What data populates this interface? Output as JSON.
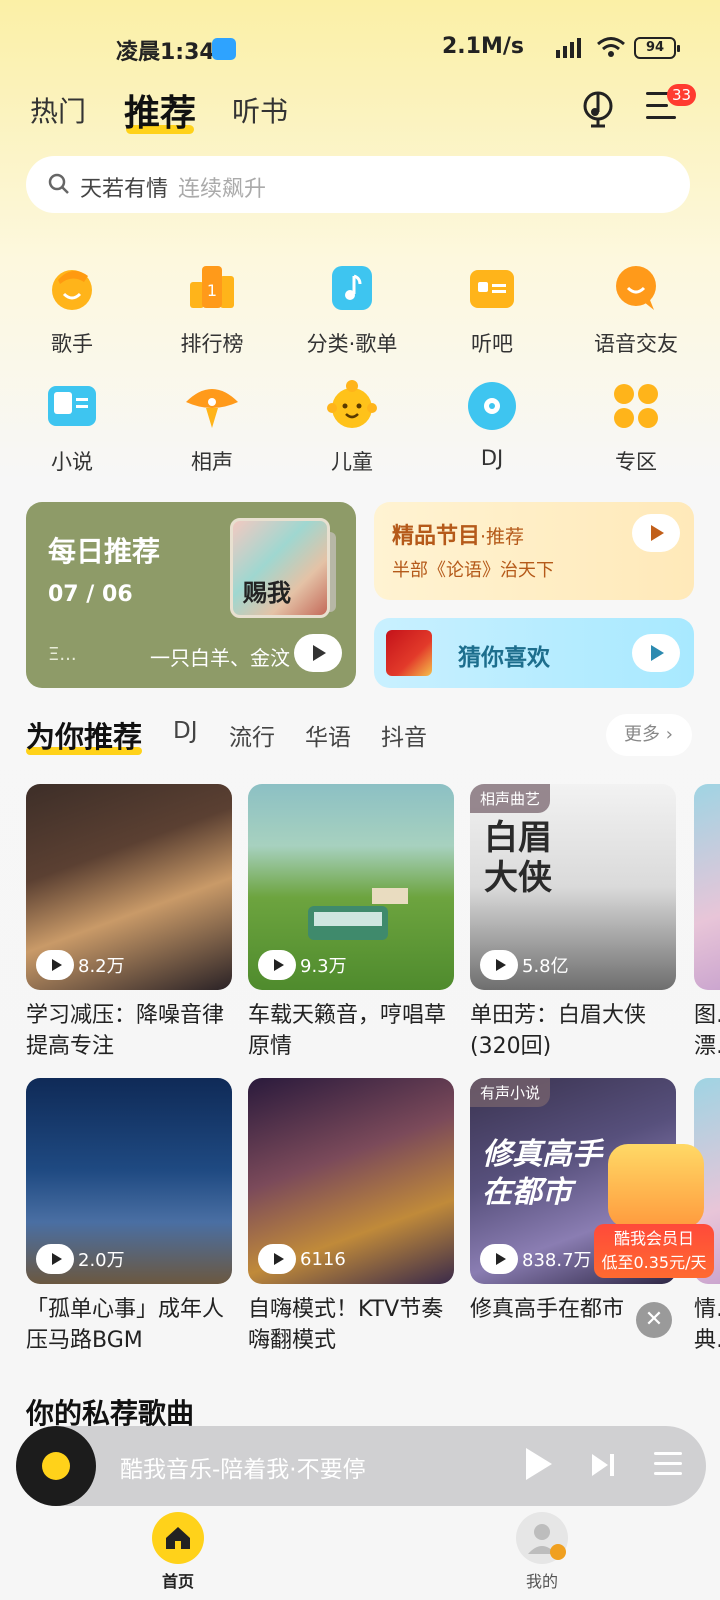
{
  "status_bar": {
    "time": "凌晨1:34",
    "net_speed": "2.1M/s",
    "battery": "94"
  },
  "top_tabs": [
    {
      "label": "热门",
      "active": false
    },
    {
      "label": "推荐",
      "active": true
    },
    {
      "label": "听书",
      "active": false
    }
  ],
  "menu_badge": "33",
  "search": {
    "keyword": "天若有情",
    "hint": "连续飙升",
    "icon": "search-icon"
  },
  "grid": [
    {
      "label": "歌手",
      "icon": "singer-icon",
      "color": "#ffb41a"
    },
    {
      "label": "排行榜",
      "icon": "chart-icon",
      "color": "#ff9a1a"
    },
    {
      "label": "分类·歌单",
      "icon": "music-note-icon",
      "color": "#3ec5f0"
    },
    {
      "label": "听吧",
      "icon": "radio-icon",
      "color": "#ffb41a"
    },
    {
      "label": "语音交友",
      "icon": "chat-icon",
      "color": "#ff9a1a"
    },
    {
      "label": "小说",
      "icon": "book-icon",
      "color": "#3ec5f0"
    },
    {
      "label": "相声",
      "icon": "fan-icon",
      "color": "#ff9a1a"
    },
    {
      "label": "儿童",
      "icon": "kid-icon",
      "color": "#ffc21a"
    },
    {
      "label": "DJ",
      "icon": "disc-icon",
      "color": "#3ec5f0"
    },
    {
      "label": "专区",
      "icon": "apps-icon",
      "color": "#ffb41a"
    }
  ],
  "daily": {
    "title": "每日推荐",
    "date_m": "07",
    "date_sep": "/",
    "date_d": "06",
    "cover_text": "赐我",
    "dots": "Ξ...",
    "artist": "一只白羊、金汶"
  },
  "jingpin": {
    "title": "精品节目",
    "suffix": "·推荐",
    "subtitle": "半部《论语》治天下"
  },
  "guess": {
    "title": "猜你喜欢"
  },
  "section_tabs": [
    {
      "label": "为你推荐",
      "active": true
    },
    {
      "label": "DJ",
      "active": false
    },
    {
      "label": "流行",
      "active": false
    },
    {
      "label": "华语",
      "active": false
    },
    {
      "label": "抖音",
      "active": false
    }
  ],
  "more": "更多",
  "playlists": [
    {
      "title": "学习减压：降噪音律提高专注",
      "count": "8.2万",
      "tag": ""
    },
    {
      "title": "车载天籁音，哼唱草原情",
      "count": "9.3万",
      "tag": ""
    },
    {
      "title": "单田芳：白眉大侠(320回)",
      "count": "5.8亿",
      "tag": "相声曲艺",
      "cover_text": "白眉大侠"
    },
    {
      "title": "图…漂…",
      "count": "",
      "tag": ""
    },
    {
      "title": "「孤单心事」成年人压马路BGM",
      "count": "2.0万",
      "tag": ""
    },
    {
      "title": "自嗨模式！KTV节奏嗨翻模式",
      "count": "6116",
      "tag": ""
    },
    {
      "title": "修真高手在都市",
      "count": "838.7万",
      "tag": "有声小说",
      "cover_text": "修真高手在都市"
    },
    {
      "title": "情…典…",
      "count": "",
      "tag": ""
    }
  ],
  "promo": {
    "line1": "酷我会员日",
    "line2": "低至0.35元/天"
  },
  "private_title": "你的私荐歌曲",
  "player": {
    "track": "酷我音乐-陪着我·不要停"
  },
  "bottom_nav": [
    {
      "label": "首页",
      "icon": "home-icon",
      "active": true
    },
    {
      "label": "我的",
      "icon": "profile-icon",
      "active": false
    }
  ]
}
